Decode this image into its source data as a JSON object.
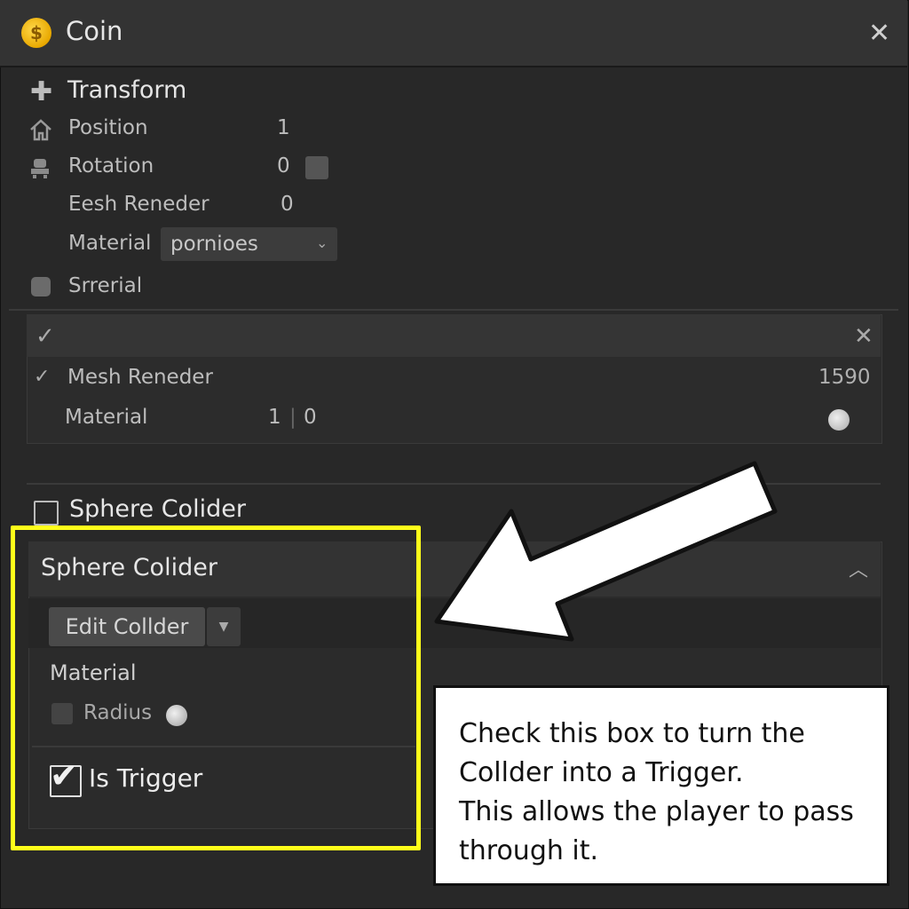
{
  "window": {
    "title": "Coin",
    "icon": "coin-icon",
    "close": "✕"
  },
  "transform": {
    "header": "Transform",
    "rows": [
      {
        "label": "Position",
        "value": "1",
        "icon": "home-icon"
      },
      {
        "label": "Rotation",
        "value": "0",
        "icon": "rotation-icon"
      },
      {
        "label": "Eesh Reneder",
        "value": "0"
      }
    ],
    "material_label": "Material",
    "material_value": "pornioes",
    "srerial_label": "Srrerial"
  },
  "mesh_renderer": {
    "label": "Mesh Reneder",
    "count": "1590",
    "material_label": "Material",
    "material_val1": "1",
    "material_sep": "|",
    "material_val2": "0"
  },
  "sphere_collider_toggle": {
    "label": "Sphere Colider",
    "checked": false
  },
  "sphere_collider": {
    "title": "Sphere Colider",
    "edit_button": "Edit Collder",
    "material_label": "Material",
    "radius_label": "Radius",
    "is_trigger_label": "Is Trigger",
    "is_trigger_checked": true
  },
  "callout": {
    "lines": [
      "Check this box to turn the",
      "Collder into a Trigger.",
      "This allows the player to pass",
      "through it."
    ]
  },
  "colors": {
    "highlight": "#ffff1a",
    "panel": "#282828"
  }
}
